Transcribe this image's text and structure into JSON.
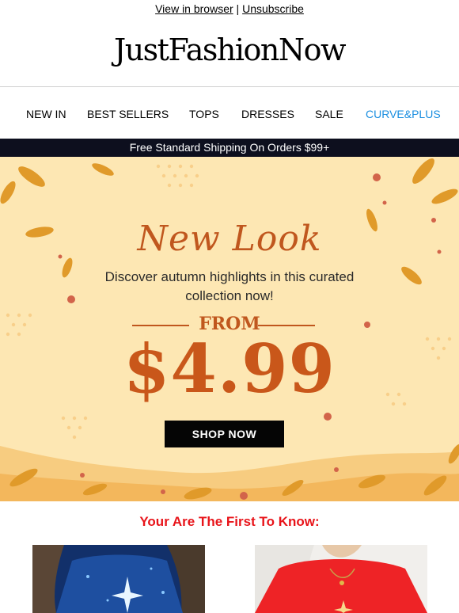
{
  "header": {
    "view_in_browser": "View in browser",
    "separator": "|",
    "unsubscribe": "Unsubscribe",
    "logo": "JustFashionNow"
  },
  "nav": {
    "items": [
      "NEW IN",
      "BEST SELLERS",
      "TOPS",
      "DRESSES",
      "SALE",
      "CURVE&PLUS"
    ],
    "highlight_color": "#1a8ee0"
  },
  "shipping_bar": {
    "text": "Free Standard Shipping On Orders $99+"
  },
  "hero": {
    "script_title": "New Look",
    "subtitle_line1": "Discover autumn highlights in this curated",
    "subtitle_line2": "collection now!",
    "from_label": "FROM",
    "price": "$4.99",
    "cta": "SHOP NOW",
    "accent_color": "#c0571e",
    "background_color": "#fde7b3"
  },
  "section": {
    "title": "Your Are The First To Know:",
    "title_color": "#e8141a"
  },
  "products": [
    {
      "name": "product-blue-sweatshirt",
      "color": "#1d3d7e"
    },
    {
      "name": "product-red-sweatshirt",
      "color": "#ee2326"
    }
  ]
}
